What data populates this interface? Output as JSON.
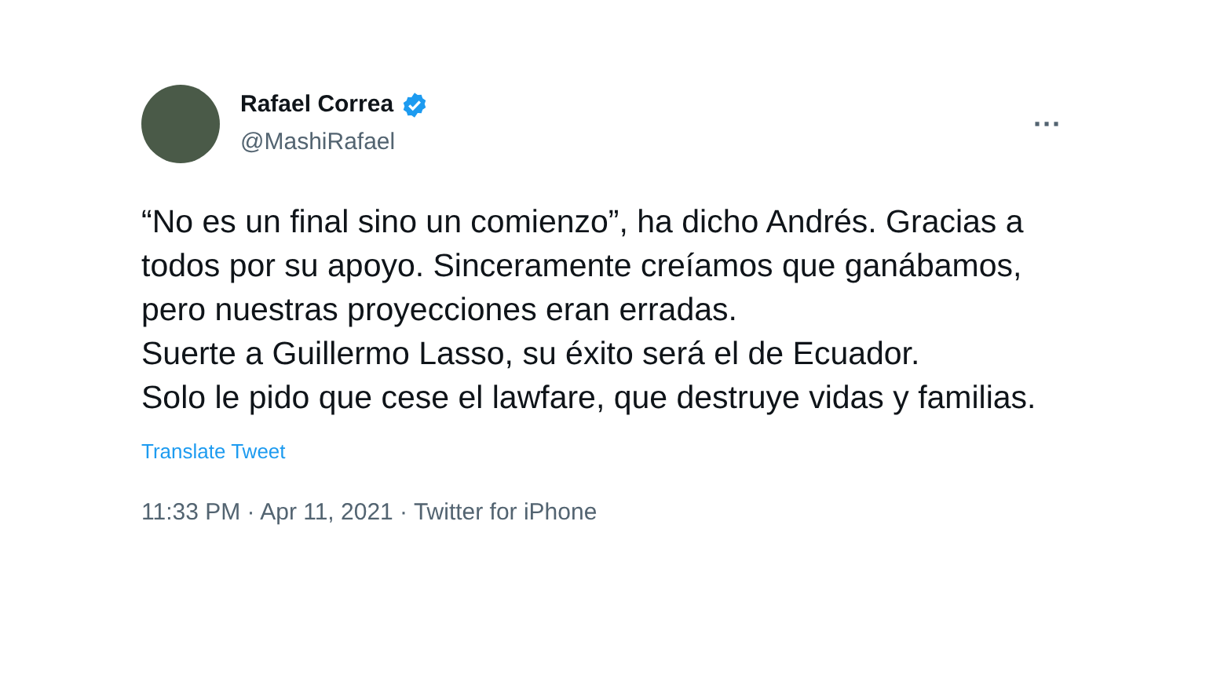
{
  "author": {
    "name": "Rafael Correa",
    "verified": true,
    "handle": "@MashiRafael"
  },
  "more": "···",
  "text": "“No es un final sino un comienzo”, ha dicho Andrés. Gracias a todos por su apoyo. Sinceramente creíamos que ganábamos, pero nuestras proyecciones eran erradas.\nSuerte a Guillermo Lasso, su éxito será el de Ecuador.\nSolo le pido que cese el lawfare, que destruye vidas y familias.",
  "translate": "Translate Tweet",
  "meta": "11:33 PM · Apr 11, 2021 · Twitter for iPhone"
}
